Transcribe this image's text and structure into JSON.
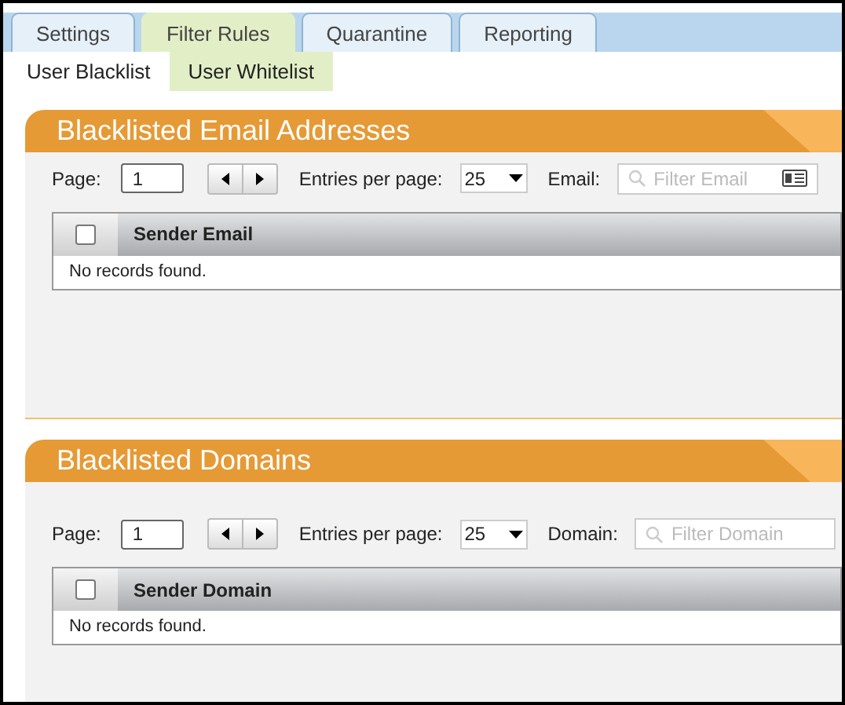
{
  "tabs": [
    {
      "label": "Settings",
      "selected": false
    },
    {
      "label": "Filter Rules",
      "selected": true
    },
    {
      "label": "Quarantine",
      "selected": false
    },
    {
      "label": "Reporting",
      "selected": false
    }
  ],
  "subtabs": [
    {
      "label": "User Blacklist",
      "selected": true
    },
    {
      "label": "User Whitelist",
      "selected": false
    }
  ],
  "sections": [
    {
      "title": "Blacklisted Email Addresses",
      "page_label": "Page:",
      "page_value": "1",
      "entries_label": "Entries per page:",
      "entries_value": "25",
      "filter_label": "Email:",
      "filter_placeholder": "Filter Email",
      "filter_has_card_icon": true,
      "select_all_checked": false,
      "column": "Sender Email",
      "empty_text": "No records found."
    },
    {
      "title": "Blacklisted Domains",
      "page_label": "Page:",
      "page_value": "1",
      "entries_label": "Entries per page:",
      "entries_value": "25",
      "filter_label": "Domain:",
      "filter_placeholder": "Filter Domain",
      "filter_has_card_icon": false,
      "select_all_checked": false,
      "column": "Sender Domain",
      "empty_text": "No records found."
    }
  ]
}
